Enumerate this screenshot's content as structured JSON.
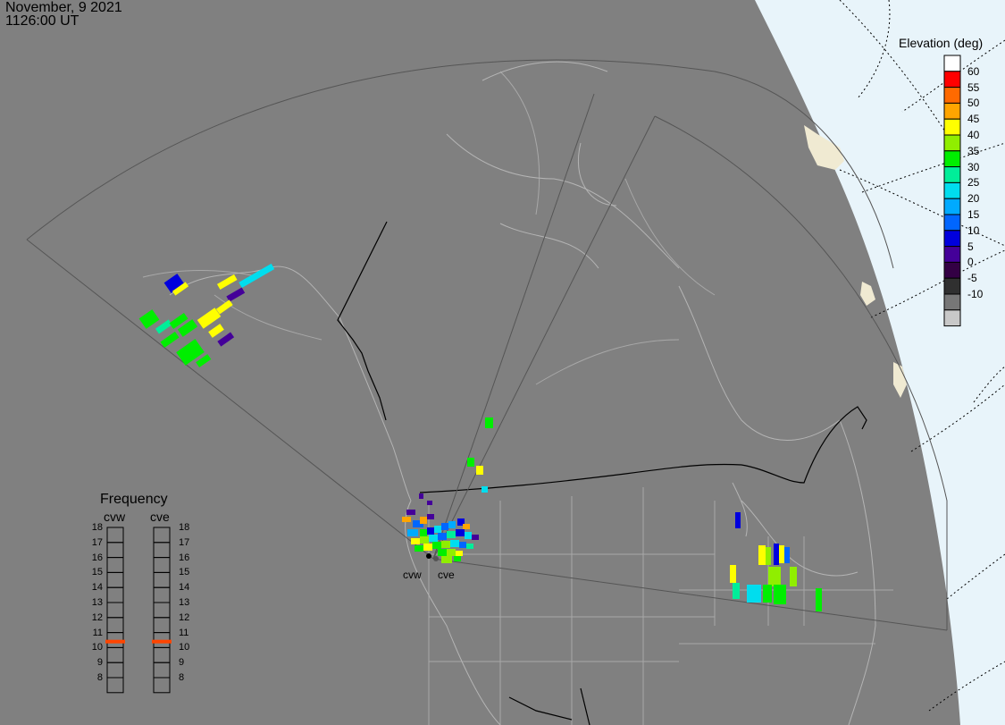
{
  "header": {
    "date": "November, 9 2021",
    "time": "1126:00 UT"
  },
  "colorbar": {
    "title": "Elevation (deg)",
    "levels": [
      {
        "label": "60",
        "color": "#ff0000"
      },
      {
        "label": "55",
        "color": "#ff6a00"
      },
      {
        "label": "50",
        "color": "#ffa500"
      },
      {
        "label": "45",
        "color": "#ffff00"
      },
      {
        "label": "40",
        "color": "#90ee00"
      },
      {
        "label": "35",
        "color": "#00ee00"
      },
      {
        "label": "30",
        "color": "#00ee99"
      },
      {
        "label": "25",
        "color": "#00ddee"
      },
      {
        "label": "20",
        "color": "#00aaff"
      },
      {
        "label": "15",
        "color": "#0066ff"
      },
      {
        "label": "10",
        "color": "#0000dd"
      },
      {
        "label": "5",
        "color": "#440099"
      },
      {
        "label": "0",
        "color": "#330044"
      },
      {
        "label": "-5",
        "color": "#303030"
      },
      {
        "label": "-10",
        "color": "#777777"
      },
      {
        "label": "",
        "color": "#c8c8c8"
      }
    ],
    "top_color": "#ffffff"
  },
  "frequency": {
    "title": "Frequency",
    "columns": [
      "cvw",
      "cve"
    ],
    "scale": [
      "18",
      "17",
      "16",
      "15",
      "14",
      "13",
      "12",
      "11",
      "10",
      "9",
      "8"
    ],
    "current_mhz": [
      10.9,
      10.9
    ],
    "marker_color": "#ff4500"
  },
  "sites": [
    "cvw",
    "cve"
  ],
  "colors": {
    "background": "#808080",
    "ocean": "#e8f4fa",
    "land_edge": "#f0ead2"
  }
}
